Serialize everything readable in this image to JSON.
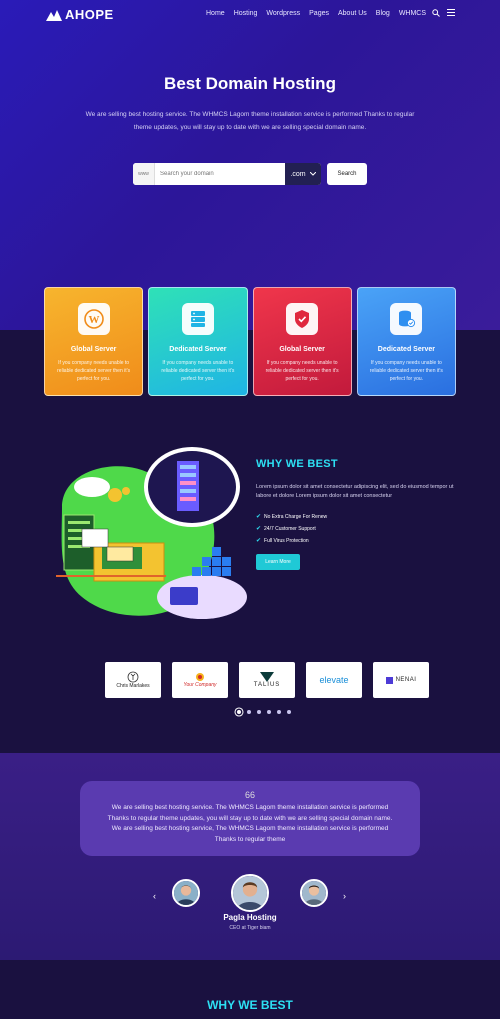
{
  "brand": {
    "name": "AHOPE"
  },
  "nav": {
    "items": [
      "Home",
      "Hosting",
      "Wordpress",
      "Pages",
      "About Us",
      "Blog",
      "WHMCS"
    ],
    "search_icon": "search-icon",
    "menu_icon": "hamburger-icon"
  },
  "hero": {
    "title": "Best Domain Hosting",
    "subtitle": "We are selling best hosting service. The WHMCS Lagom theme installation service is performed Thanks to regular theme updates, you will stay up to date with we are selling special domain name.",
    "search": {
      "prefix": "www",
      "placeholder": "Search your domain",
      "tld": ".com",
      "button": "Search"
    }
  },
  "services": [
    {
      "title": "Global Server",
      "desc": "If you company needs unable to reliable dedicated server then it's perfect for you.",
      "icon": "wordpress-icon",
      "color": "#f5a623"
    },
    {
      "title": "Dedicated Server",
      "desc": "If you company needs unable to reliable dedicated server then it's perfect for you.",
      "icon": "server-icon",
      "color": "#22d3c7"
    },
    {
      "title": "Global Server",
      "desc": "If you company needs unable to reliable dedicated server then it's perfect for you.",
      "icon": "shield-icon",
      "color": "#e0283e"
    },
    {
      "title": "Dedicated Server",
      "desc": "If you company needs unable to reliable dedicated server then it's perfect for you.",
      "icon": "database-icon",
      "color": "#2f8ff0"
    }
  ],
  "why": {
    "title": "WHY WE BEST",
    "text": "Lorem ipsum dolor sit amet consectetur adipiscing elit, sed do eiusmod tempor ut labore et dolore Lorem ipsum dolor sit amet consectetur",
    "features": [
      "No Extra Charge For Renew",
      "24/7 Customer Support",
      "Full Virus Protection"
    ],
    "button": "Learn More"
  },
  "clients": [
    "Chris Marlakes",
    "Your Company",
    "TALIUS",
    "elevate",
    "NENAI"
  ],
  "testimonial": {
    "quote_mark": "66",
    "text": "We are selling best hosting service. The WHMCS Lagom theme installation service is performed Thanks to regular theme updates, you will stay up to date with we are selling special domain name. We are selling best hosting service, The WHMCS Lagom theme installation service is performed Thanks to regular theme",
    "name": "Pagla Hosting",
    "role": "CEO at Tiger biam",
    "prev": "‹",
    "next": "›"
  },
  "bottom": {
    "title": "WHY WE BEST"
  },
  "colors": {
    "accent": "#2de0f3",
    "hero": "#2a1bb8",
    "dark": "#1a1140"
  }
}
